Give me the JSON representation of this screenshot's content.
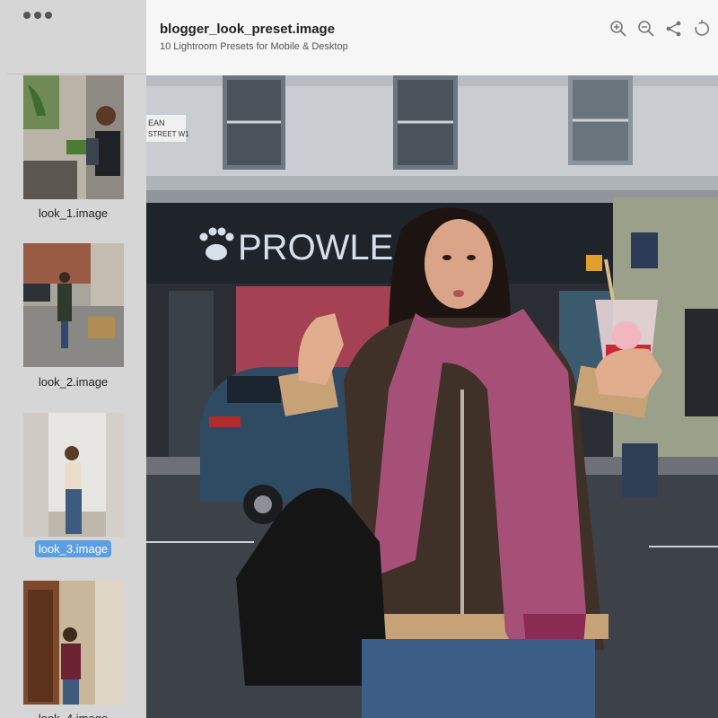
{
  "window": {
    "menu_icon": "more-dots-icon"
  },
  "header": {
    "title": "blogger_look_preset.image",
    "subtitle": "10 Lightroom Presets for Mobile & Desktop",
    "tools": [
      {
        "icon": "zoom-in-icon"
      },
      {
        "icon": "zoom-out-icon"
      },
      {
        "icon": "share-icon"
      },
      {
        "icon": "rotate-icon"
      }
    ]
  },
  "sidebar": {
    "items": [
      {
        "label": "look_1.image",
        "selected": false
      },
      {
        "label": "look_2.image",
        "selected": false
      },
      {
        "label": "look_3.image",
        "selected": true
      },
      {
        "label": "look_4.image",
        "selected": false
      }
    ]
  },
  "photo": {
    "store_sign": "PROWLE",
    "street_sign_line1": "EAN",
    "street_sign_line2": "STREET W1"
  },
  "colors": {
    "accent": "#5a9fe6",
    "sidebar_bg": "#d6d6d6",
    "header_bg": "#f6f6f6"
  }
}
